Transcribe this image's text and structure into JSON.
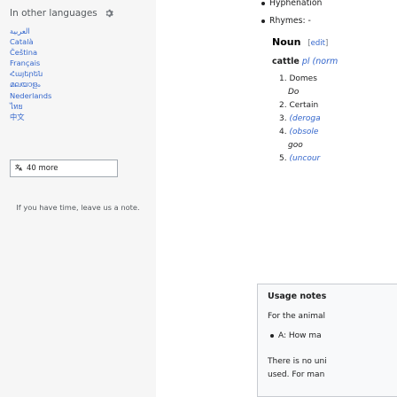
{
  "sidebar": {
    "header": "In other languages",
    "languages": [
      "العربية",
      "Català",
      "Čeština",
      "Français",
      "Հայերեն",
      "മലയാളം",
      "Nederlands",
      "ไทย",
      "中文"
    ],
    "more_button": "40 more",
    "note": "If you have time, leave us a note."
  },
  "content": {
    "pron_items": [
      "Hyphenation",
      "Rhymes: -"
    ],
    "noun_title": "Noun",
    "edit_label": "edit",
    "headword": "cattle",
    "headword_gloss": "pl (norm",
    "senses": [
      {
        "num": "1.",
        "text": "Domes"
      },
      {
        "num": "",
        "text": "Do"
      },
      {
        "num": "2.",
        "text": "Certain"
      },
      {
        "num": "3.",
        "text": "(deroga"
      },
      {
        "num": "4.",
        "text": "(obsole"
      },
      {
        "num": "",
        "text": "goo"
      },
      {
        "num": "5.",
        "text": "(uncour"
      }
    ],
    "usage_title": "Usage notes",
    "usage_line1": "For the animal",
    "usage_bullet": "A: How ma",
    "usage_line3a": "There is no uni",
    "usage_line3b": "used. For man"
  }
}
